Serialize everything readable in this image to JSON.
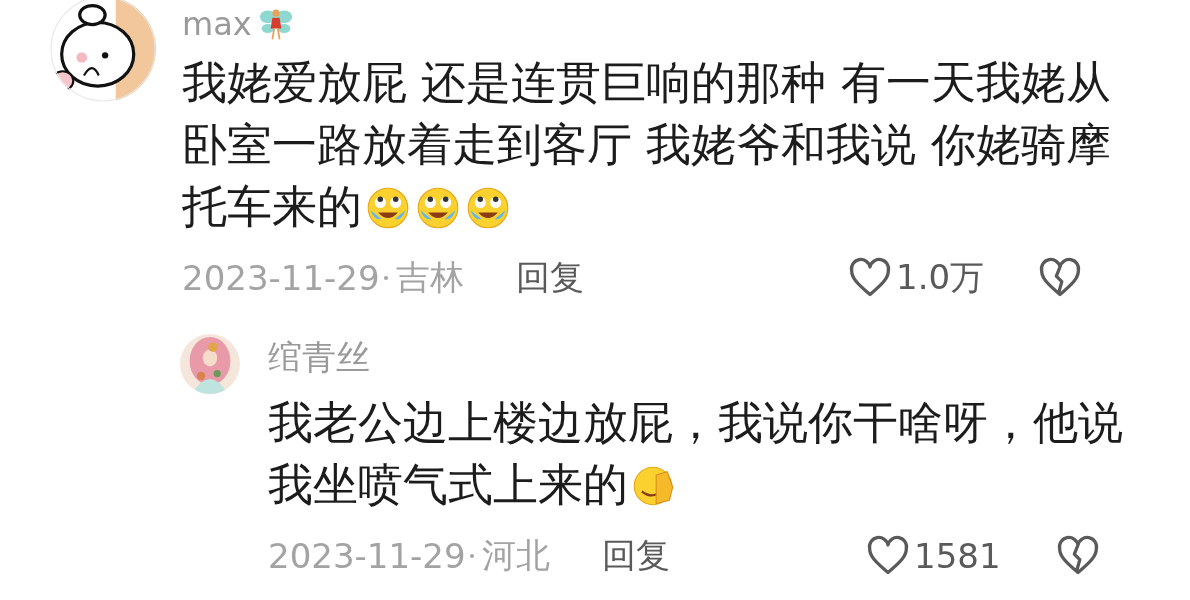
{
  "comments": [
    {
      "author": "max",
      "badge": true,
      "text": "我姥爱放屁 还是连贯巨响的那种 有一天我姥从卧室一路放着走到客厅 我姥爷和我说 你姥骑摩托车来的",
      "emojis": [
        {
          "kind": "crying-laugh"
        },
        {
          "kind": "crying-laugh"
        },
        {
          "kind": "crying-laugh"
        }
      ],
      "date": "2023-11-29",
      "location": "吉林",
      "reply_label": "回复",
      "likes": "1.0万",
      "liked": false,
      "disliked": false,
      "replies": [
        {
          "author": "绾青丝",
          "badge": false,
          "text": "我老公边上楼边放屁，我说你干啥呀，他说我坐喷气式上来的",
          "emojis": [
            {
              "kind": "facepalm"
            }
          ],
          "date": "2023-11-29",
          "location": "河北",
          "reply_label": "回复",
          "likes": "1581",
          "liked": false,
          "disliked": false
        }
      ]
    }
  ]
}
